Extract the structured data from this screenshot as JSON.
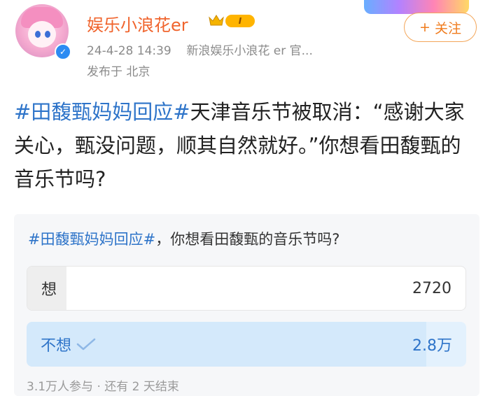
{
  "header": {
    "username": "娱乐小浪花er",
    "level_badge": "I",
    "timestamp": "24-4-28 14:39",
    "source": "新浪娱乐小浪花 er 官...",
    "location": "发布于 北京",
    "follow_label": "关注",
    "follow_icon": "+"
  },
  "post": {
    "hashtag": "#田馥甄妈妈回应#",
    "text": "天津音乐节被取消：“感谢大家关心，甄没问题，顺其自然就好。”你想看田馥甄的音乐节吗?"
  },
  "poll": {
    "hashtag": "#田馥甄妈妈回应#",
    "question": "，你想看田馥甄的音乐节吗?",
    "options": [
      {
        "label": "想",
        "count": "2720",
        "fraction": 0.09,
        "selected": false
      },
      {
        "label": "不想",
        "count": "2.8万",
        "fraction": 0.91,
        "selected": true
      }
    ],
    "footer": "3.1万人参与 · 还有 2 天结束"
  },
  "colors": {
    "username": "#f0642d",
    "link": "#2e74c9",
    "follow": "#f07b1d",
    "selected_bg": "#e3f1fd"
  }
}
